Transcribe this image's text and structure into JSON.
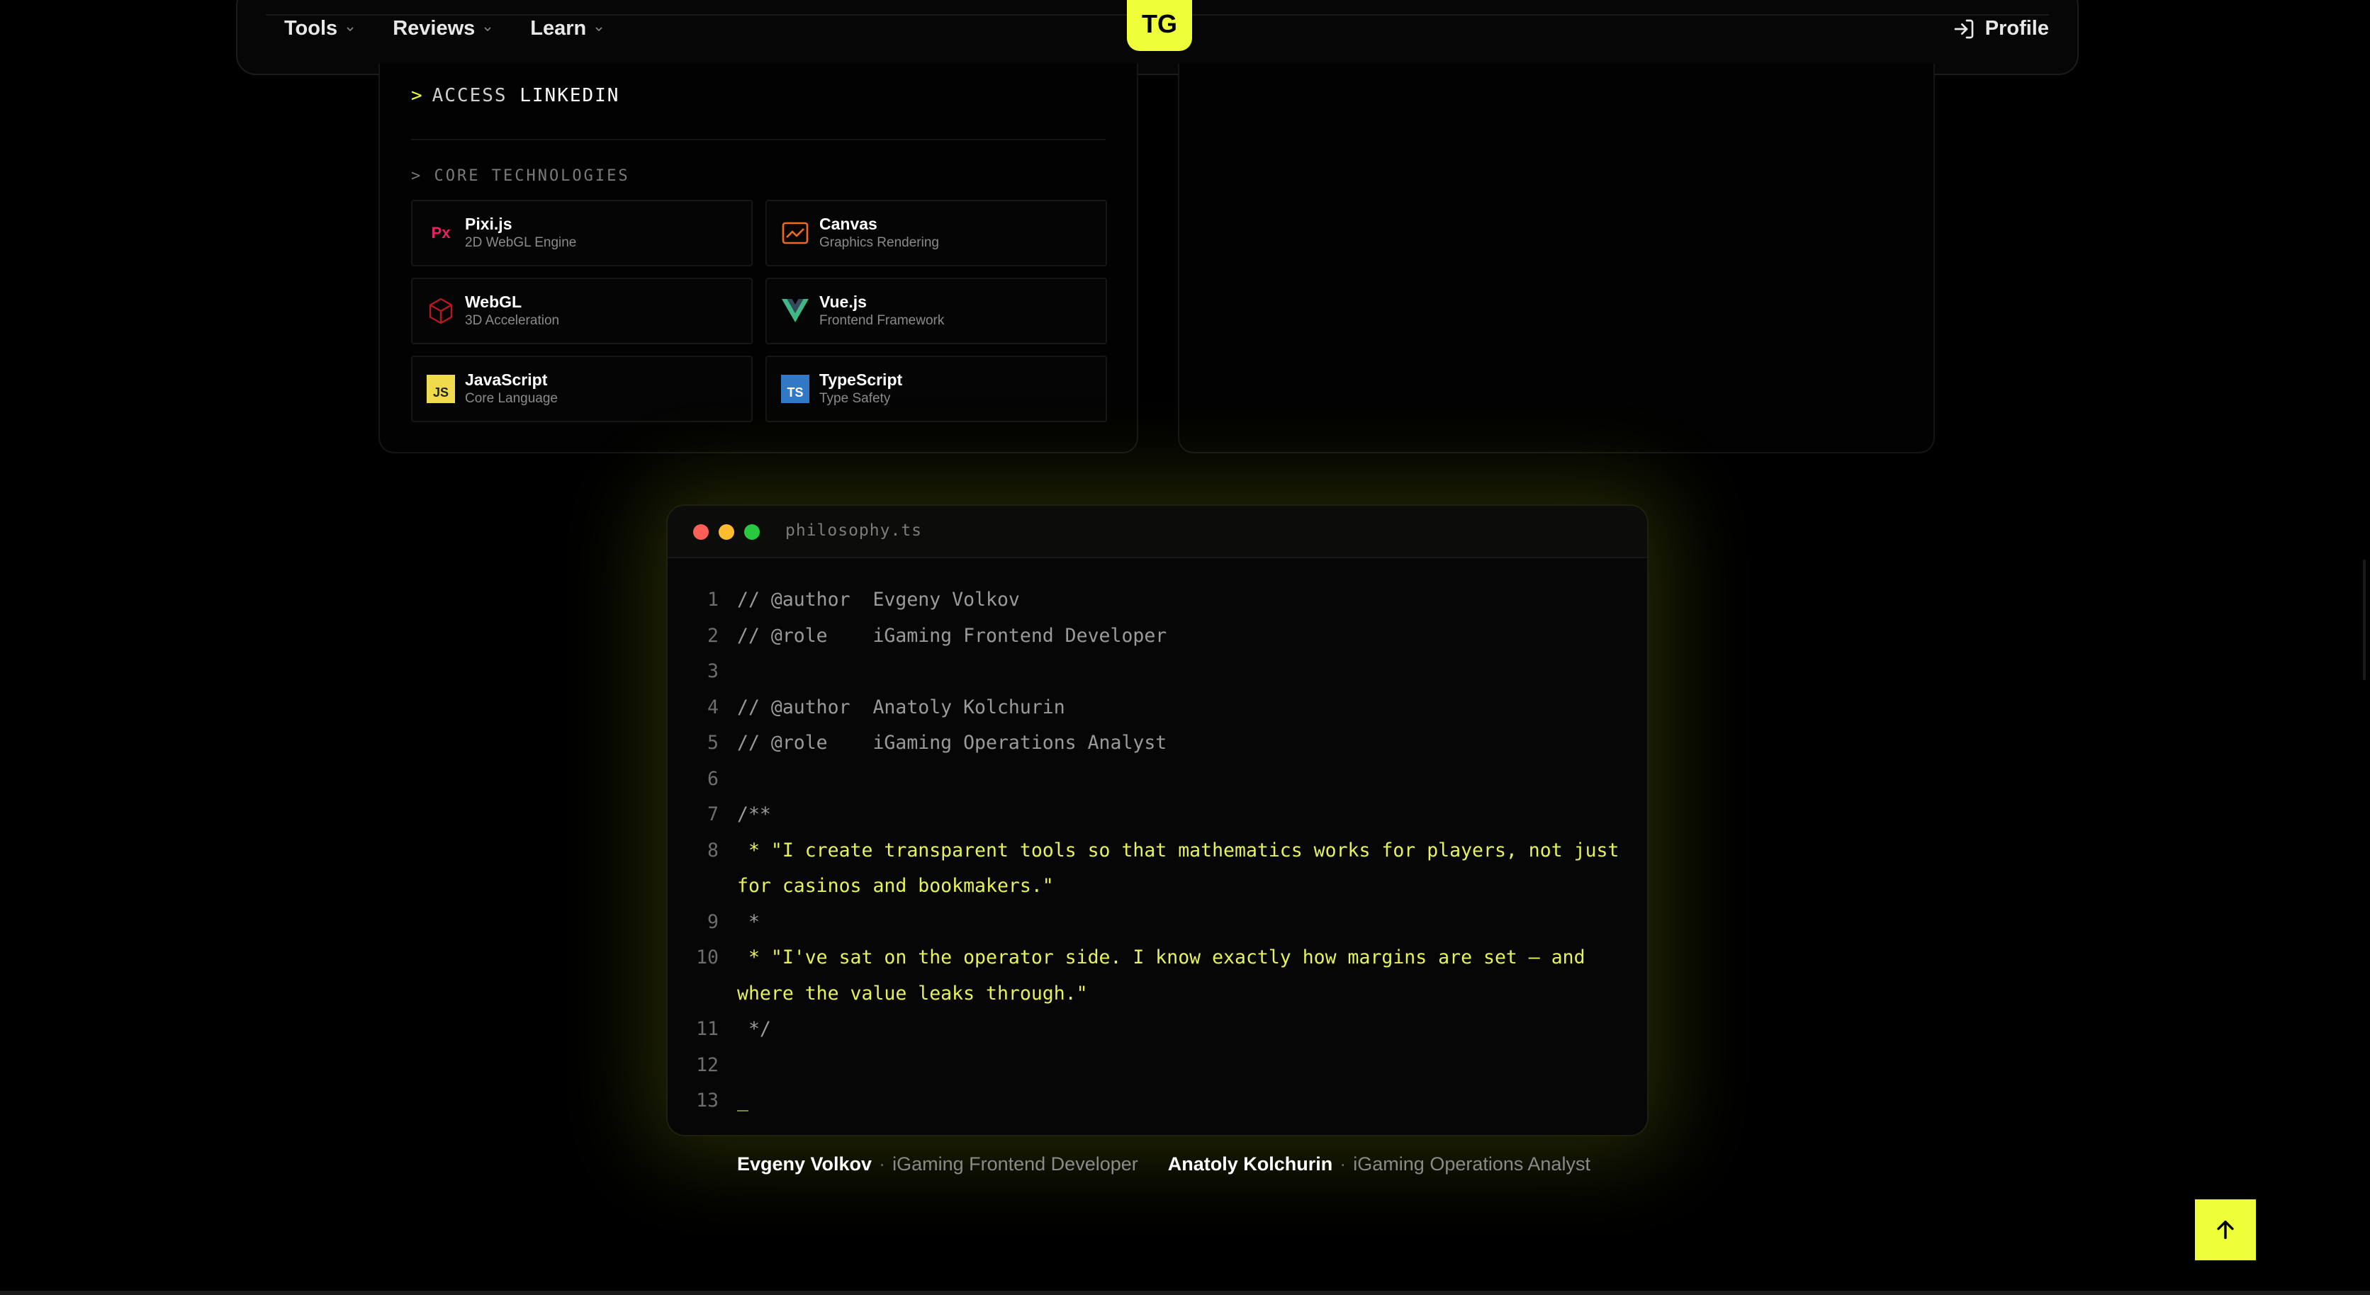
{
  "nav": {
    "items": [
      {
        "label": "Tools"
      },
      {
        "label": "Reviews"
      },
      {
        "label": "Learn"
      }
    ],
    "logo": "TG",
    "profile": "Profile"
  },
  "card": {
    "access_prefix": ">",
    "access_word": "ACCESS",
    "access_target": "LINKEDIN",
    "core_title": "> CORE TECHNOLOGIES",
    "tech": [
      {
        "name": "Pixi.js",
        "desc": "2D WebGL Engine",
        "icon": "pixijs-icon",
        "glyph": "Px"
      },
      {
        "name": "Canvas",
        "desc": "Graphics Rendering",
        "icon": "canvas-chart-icon",
        "glyph": ""
      },
      {
        "name": "WebGL",
        "desc": "3D Acceleration",
        "icon": "webgl-cube-icon",
        "glyph": ""
      },
      {
        "name": "Vue.js",
        "desc": "Frontend Framework",
        "icon": "vuejs-icon",
        "glyph": ""
      },
      {
        "name": "JavaScript",
        "desc": "Core Language",
        "icon": "javascript-icon",
        "glyph": "JS"
      },
      {
        "name": "TypeScript",
        "desc": "Type Safety",
        "icon": "typescript-icon",
        "glyph": "TS"
      }
    ]
  },
  "code": {
    "filename": "philosophy.ts",
    "lines": [
      {
        "n": "1",
        "text": "// @author  Evgeny Volkov",
        "hl": false
      },
      {
        "n": "2",
        "text": "// @role    iGaming Frontend Developer",
        "hl": false
      },
      {
        "n": "3",
        "text": "",
        "hl": false
      },
      {
        "n": "4",
        "text": "// @author  Anatoly Kolchurin",
        "hl": false
      },
      {
        "n": "5",
        "text": "// @role    iGaming Operations Analyst",
        "hl": false
      },
      {
        "n": "6",
        "text": "",
        "hl": false
      },
      {
        "n": "7",
        "text": "/**",
        "hl": false
      },
      {
        "n": "8",
        "text": " * \"I create transparent tools so that mathematics works for players, not just",
        "hl": true
      },
      {
        "n": "",
        "text": "for casinos and bookmakers.\"",
        "hl": true
      },
      {
        "n": "9",
        "text": " *",
        "hl": false
      },
      {
        "n": "10",
        "text": " * \"I've sat on the operator side. I know exactly how margins are set — and",
        "hl": true
      },
      {
        "n": "",
        "text": "where the value leaks through.\"",
        "hl": true
      },
      {
        "n": "11",
        "text": " */",
        "hl": false
      },
      {
        "n": "12",
        "text": "",
        "hl": false
      },
      {
        "n": "13",
        "text": "_",
        "hl": true
      }
    ]
  },
  "credits": [
    {
      "name": "Evgeny Volkov",
      "sep": "·",
      "role": "iGaming Frontend Developer"
    },
    {
      "name": "Anatoly Kolchurin",
      "sep": "·",
      "role": "iGaming Operations Analyst"
    }
  ],
  "colors": {
    "accent": "#eeff3a",
    "background": "#000000",
    "code_highlight": "#e6f25a"
  }
}
